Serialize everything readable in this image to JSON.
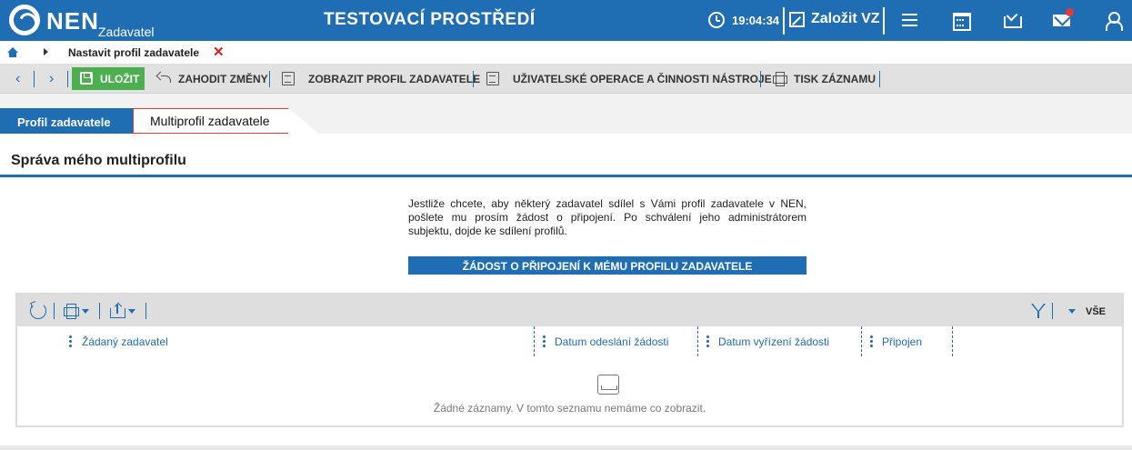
{
  "header": {
    "brand": "NEN",
    "brand_sub": "Zadavatel",
    "environment": "TESTOVACÍ PROSTŘEDÍ",
    "time": "19:04:34",
    "new_vz": "Založit VZ"
  },
  "breadcrumb": {
    "title": "Nastavit profil zadavatele",
    "close": "✕"
  },
  "toolbar": {
    "save": "ULOŽIT",
    "discard": "ZAHODIT ZMĚNY",
    "show_profile": "ZOBRAZIT PROFIL ZADAVATELE",
    "user_ops": "UŽIVATELSKÉ OPERACE A ČINNOSTI NÁSTROJE",
    "print": "TISK ZÁZNAMU"
  },
  "tabs": [
    {
      "label": "Profil zadavatele"
    },
    {
      "label": "Multiprofil zadavatele"
    }
  ],
  "panel": {
    "title": "Správa mého multiprofilu",
    "info": "Jestliže chcete, aby některý zadavatel sdílel s Vámi profil zadavatele v NEN, pošlete mu prosím žádost o připojení. Po schválení jeho administrátorem subjektu, dojde ke sdílení profilů.",
    "request_button": "ŽÁDOST O PŘIPOJENÍ K MÉMU PROFILU ZADAVATELE"
  },
  "grid": {
    "filter_all": "VŠE",
    "columns": [
      {
        "label": "Žádaný zadavatel"
      },
      {
        "label": "Datum odeslání žádosti"
      },
      {
        "label": "Datum vyřízení žádosti"
      },
      {
        "label": "Připojen"
      }
    ],
    "empty": "Žádné záznamy. V tomto seznamu nemáme co zobrazit."
  },
  "colors": {
    "primary": "#1f6db3",
    "save": "#4caf50",
    "close": "#e02020",
    "notification": "#e53935"
  }
}
